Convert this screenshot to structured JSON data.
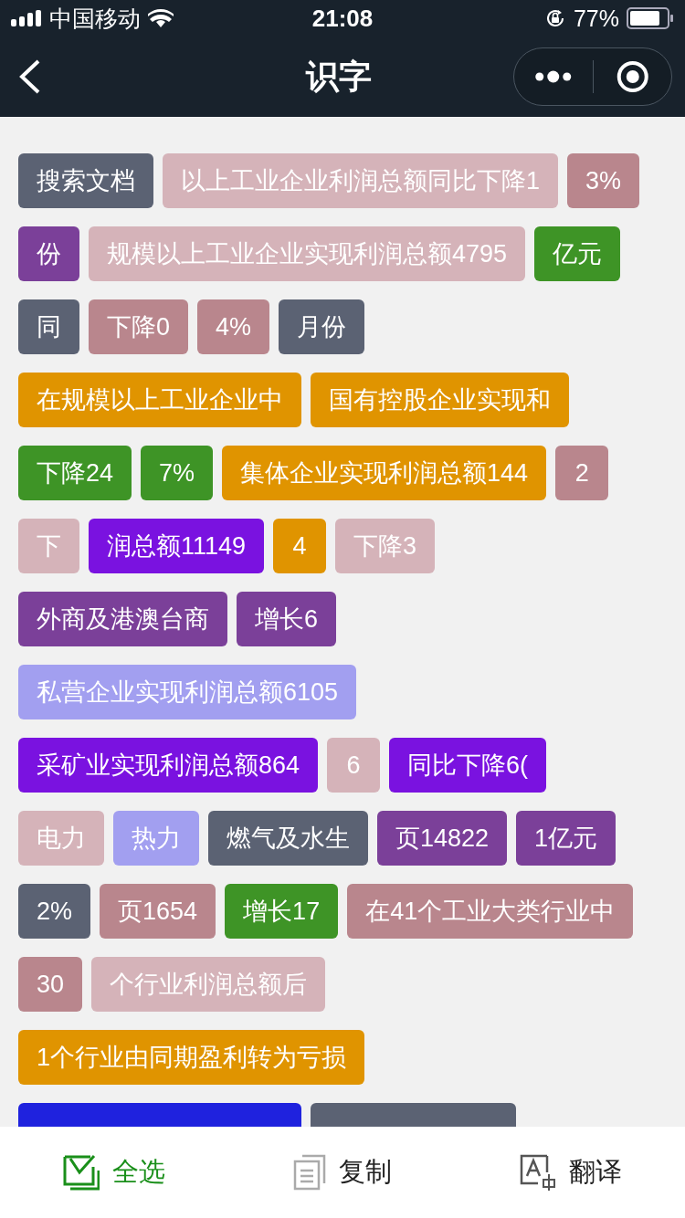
{
  "status_bar": {
    "carrier": "中国移动",
    "time": "21:08",
    "battery": "77%"
  },
  "nav": {
    "title": "识字"
  },
  "rows": [
    {
      "tags": [
        {
          "label": "搜索文档",
          "color": "#5b6273"
        },
        {
          "label": "以上工业企业利润总额同比下降1",
          "color": "#d5b3b9"
        },
        {
          "label": "3%",
          "color": "#b9868d"
        }
      ]
    },
    {
      "tags": [
        {
          "label": "份",
          "color": "#7b4099"
        },
        {
          "label": "规模以上工业企业实现利润总额4795",
          "color": "#d5b3b9"
        },
        {
          "label": "亿元",
          "color": "#3e9426"
        }
      ]
    },
    {
      "tags": [
        {
          "label": "同",
          "color": "#5b6273"
        },
        {
          "label": "下降0",
          "color": "#b9868d"
        },
        {
          "label": "4%",
          "color": "#b9868d"
        },
        {
          "label": "月份",
          "color": "#5b6273"
        }
      ]
    },
    {
      "tags": [
        {
          "label": "在规模以上工业企业中",
          "color": "#e09400"
        },
        {
          "label": "国有控股企业实现和",
          "color": "#e09400"
        }
      ]
    },
    {
      "tags": [
        {
          "label": "下降24",
          "color": "#3e9426"
        },
        {
          "label": "7%",
          "color": "#3e9426"
        },
        {
          "label": "集体企业实现利润总额144",
          "color": "#e09400"
        },
        {
          "label": "2",
          "color": "#b9868d"
        }
      ]
    },
    {
      "tags": [
        {
          "label": "下",
          "color": "#d5b3b9"
        },
        {
          "label": "润总额11149",
          "color": "#7a12e0"
        },
        {
          "label": "4",
          "color": "#e09400"
        },
        {
          "label": "下降3",
          "color": "#d5b3b9"
        }
      ]
    },
    {
      "tags": [
        {
          "label": "外商及港澳台商",
          "color": "#7b4099"
        },
        {
          "label": "增长6",
          "color": "#7b4099"
        }
      ]
    },
    {
      "tags": [
        {
          "label": "私营企业实现利润总额6105",
          "color": "#a29ff0"
        }
      ]
    },
    {
      "tags": [
        {
          "label": "采矿业实现利润总额864",
          "color": "#7a12e0"
        },
        {
          "label": "6",
          "color": "#d5b3b9"
        },
        {
          "label": "同比下降6(",
          "color": "#7a12e0"
        }
      ]
    },
    {
      "tags": [
        {
          "label": "电力",
          "color": "#d5b3b9"
        },
        {
          "label": "热力",
          "color": "#a29ff0"
        },
        {
          "label": "燃气及水生",
          "color": "#5b6273"
        },
        {
          "label": "页14822",
          "color": "#7b4099"
        },
        {
          "label": "1亿元",
          "color": "#7b4099"
        }
      ]
    },
    {
      "tags": [
        {
          "label": "2%",
          "color": "#5b6273"
        },
        {
          "label": "页1654",
          "color": "#b9868d"
        },
        {
          "label": "增长17",
          "color": "#3e9426"
        },
        {
          "label": "在41个工业大类行业中",
          "color": "#b9868d"
        }
      ]
    },
    {
      "tags": [
        {
          "label": "30",
          "color": "#b9868d"
        },
        {
          "label": "个行业利润总额后",
          "color": "#d5b3b9"
        }
      ]
    },
    {
      "tags": [
        {
          "label": "1个行业由同期盈利转为亏损",
          "color": "#e09400"
        }
      ]
    },
    {
      "tags": [
        {
          "color": "#1f22de"
        },
        {
          "color": "#5b6273"
        }
      ]
    }
  ],
  "toolbar": [
    {
      "kind": "select-all",
      "label": "全选",
      "active": true
    },
    {
      "kind": "copy",
      "label": "复制",
      "active": false
    },
    {
      "kind": "translate",
      "label": "翻译",
      "active": false
    }
  ]
}
